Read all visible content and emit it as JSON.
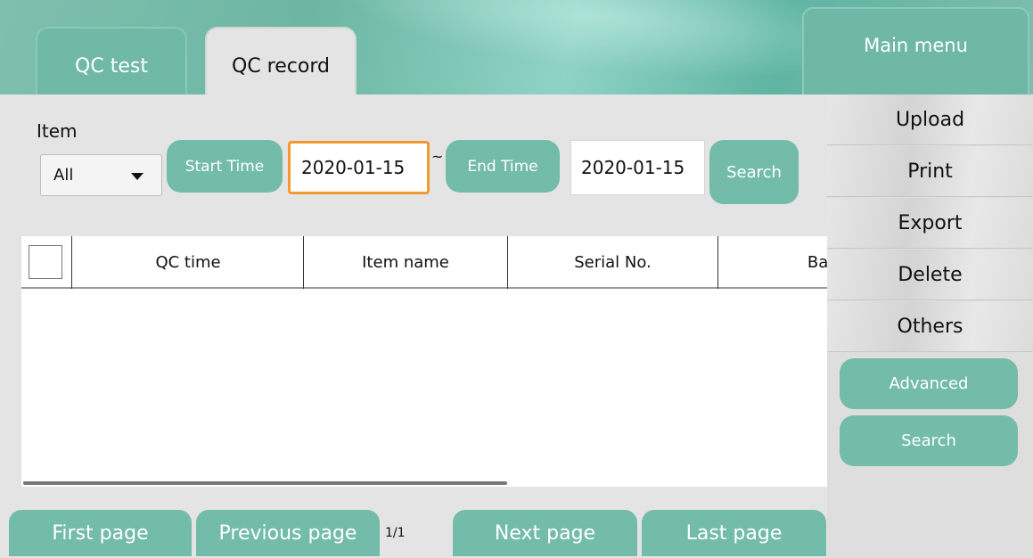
{
  "tabs": {
    "qc_test": "QC test",
    "qc_record": "QC record"
  },
  "main_menu": "Main menu",
  "sidebar": {
    "items": [
      "Upload",
      "Print",
      "Export",
      "Delete",
      "Others"
    ],
    "advanced": "Advanced",
    "search": "Search"
  },
  "filters": {
    "item_label": "Item",
    "item_value": "All",
    "start_time_label": "Start Time",
    "start_time_value": "2020-01-15",
    "separator": "~",
    "end_time_label": "End Time",
    "end_time_value": "2020-01-15",
    "search_label": "Search"
  },
  "table": {
    "columns": [
      "QC time",
      "Item name",
      "Serial No.",
      "Barc"
    ],
    "rows": []
  },
  "pagination": {
    "first": "First page",
    "previous": "Previous page",
    "indicator": "1/1",
    "next": "Next page",
    "last": "Last page"
  },
  "colors": {
    "accent": "#74bcaa",
    "focus_border": "#f29a2e",
    "background": "#e4e4e4"
  },
  "icons": {
    "dropdown": "caret-down-icon",
    "select_all": "checkbox-icon"
  }
}
